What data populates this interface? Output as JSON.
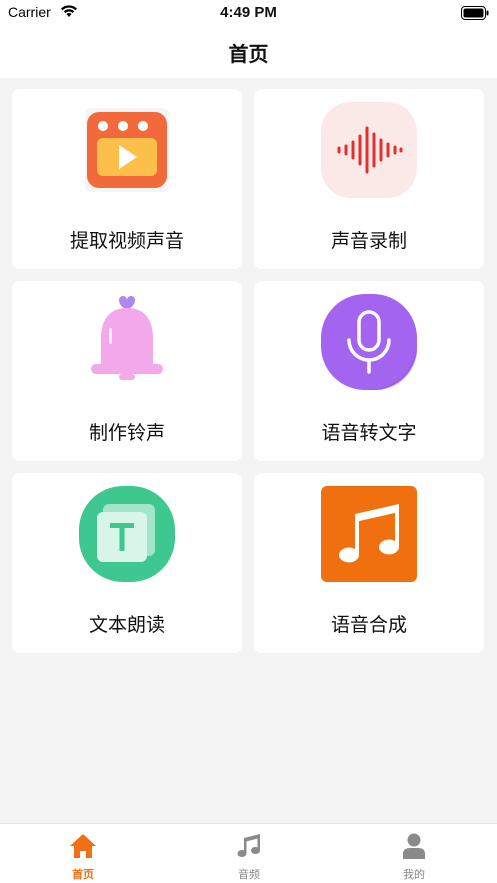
{
  "status": {
    "carrier": "Carrier",
    "time": "4:49 PM"
  },
  "nav": {
    "title": "首页"
  },
  "features": [
    {
      "label": "提取视频声音",
      "icon": "video-play-icon"
    },
    {
      "label": "声音录制",
      "icon": "sound-wave-icon"
    },
    {
      "label": "制作铃声",
      "icon": "bell-icon"
    },
    {
      "label": "语音转文字",
      "icon": "microphone-icon"
    },
    {
      "label": "文本朗读",
      "icon": "text-t-icon"
    },
    {
      "label": "语音合成",
      "icon": "music-note-icon"
    }
  ],
  "tabs": [
    {
      "label": "首页",
      "icon": "home-icon",
      "active": true
    },
    {
      "label": "音频",
      "icon": "music-note-icon",
      "active": false
    },
    {
      "label": "我的",
      "icon": "person-icon",
      "active": false
    }
  ],
  "colors": {
    "accent": "#f07018",
    "video_icon": "#f26a3c",
    "wave_bg": "#fbe9e8",
    "wave": "#e0312f",
    "bell": "#f4a8ec",
    "mic": "#a364f0",
    "text_icon": "#3ec78f",
    "music_icon": "#f07010"
  }
}
